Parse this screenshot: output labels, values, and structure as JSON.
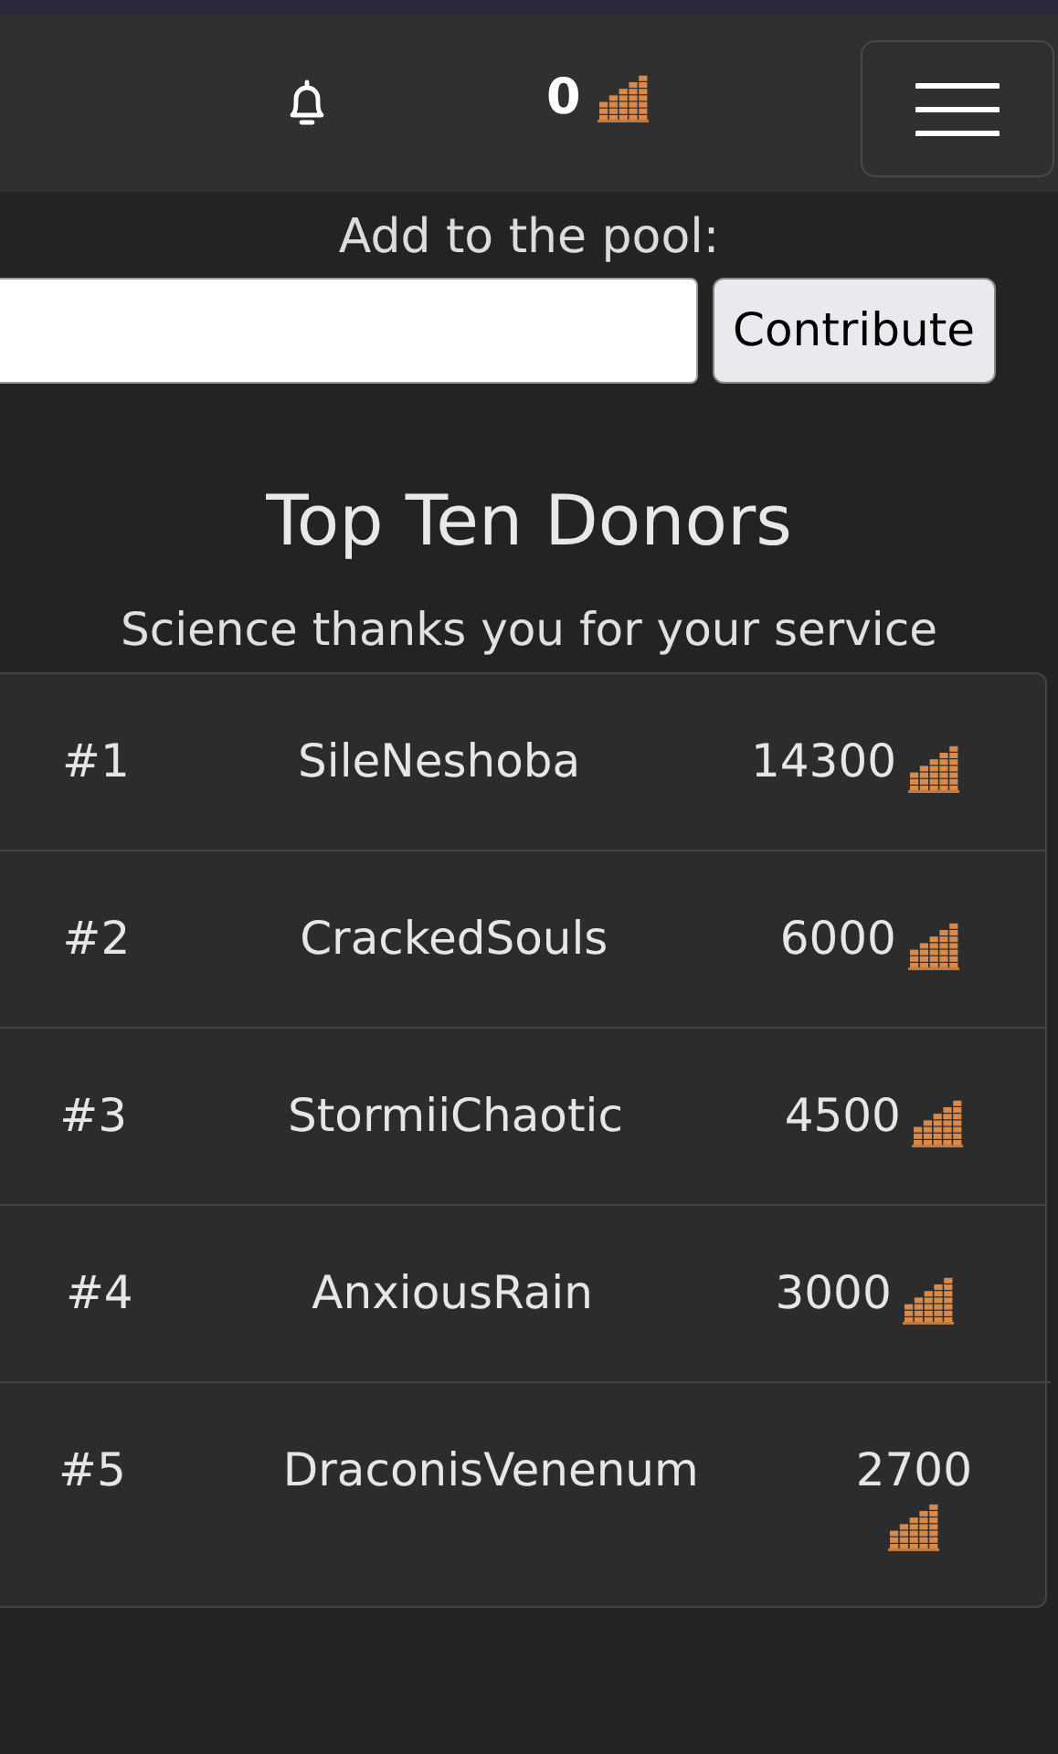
{
  "header": {
    "points": "0"
  },
  "contribute": {
    "label": "Add to the pool:",
    "button": "Contribute"
  },
  "donors": {
    "title": "Top Ten Donors",
    "subtitle": "Science thanks you for your service",
    "rows": [
      {
        "rank": "#1",
        "name": "SileNeshoba",
        "amount": "14300"
      },
      {
        "rank": "#2",
        "name": "CrackedSouls",
        "amount": "6000"
      },
      {
        "rank": "#3",
        "name": "StormiiChaotic",
        "amount": "4500"
      },
      {
        "rank": "#4",
        "name": "AnxiousRain",
        "amount": "3000"
      },
      {
        "rank": "#5",
        "name": "DraconisVenenum",
        "amount": "2700"
      }
    ]
  }
}
